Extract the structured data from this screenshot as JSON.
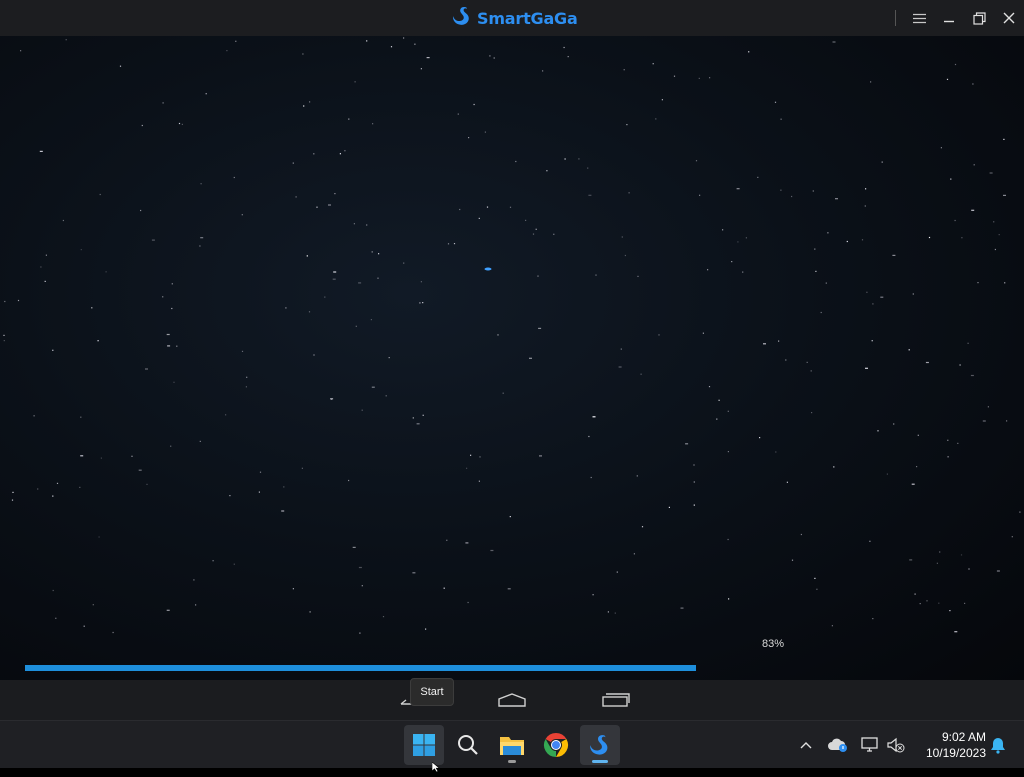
{
  "app": {
    "title": "SmartGaGa",
    "brand_color": "#2d8ef0"
  },
  "title_controls": [
    "menu-icon",
    "minimize-icon",
    "restore-icon",
    "close-icon"
  ],
  "loading": {
    "percent_label": "83%",
    "progress": 0.83,
    "accent": "#1e8fdc"
  },
  "android_nav": [
    "back-icon",
    "home-icon",
    "recents-icon"
  ],
  "tooltip": {
    "text": "Start"
  },
  "taskbar": {
    "apps": [
      "start-button",
      "search-button",
      "file-explorer",
      "chrome",
      "smartgaga"
    ],
    "tray_icons": [
      "chevron-up-icon",
      "onedrive-icon",
      "network-icon",
      "volume-muted-icon"
    ],
    "time": "9:02 AM",
    "date": "10/19/2023",
    "notification_icon": "bell-icon"
  }
}
